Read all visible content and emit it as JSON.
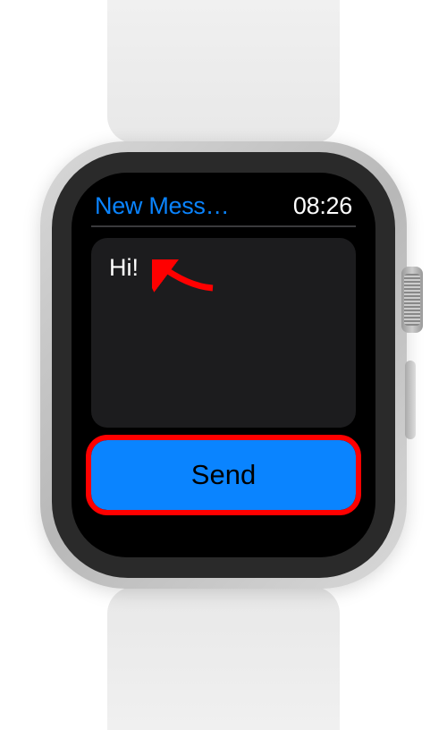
{
  "header": {
    "title": "New Mess…",
    "time": "08:26"
  },
  "message": {
    "text": "Hi!"
  },
  "actions": {
    "send_label": "Send"
  },
  "colors": {
    "accent": "#0a84ff",
    "annotation": "#ff0000"
  }
}
